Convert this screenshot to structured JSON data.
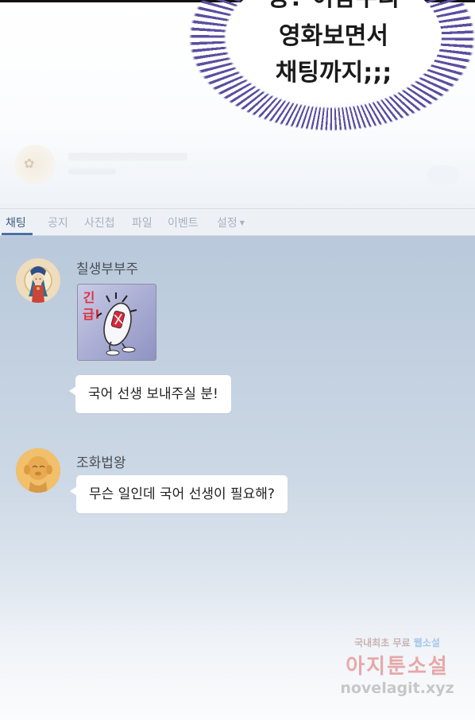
{
  "speech_bubble": {
    "line1": "응? 이참우리",
    "line2": "영화보면서",
    "line3": "채팅까지;;;"
  },
  "tabs": [
    {
      "label": "채팅",
      "active": true
    },
    {
      "label": "공지",
      "active": false
    },
    {
      "label": "사진첩",
      "active": false
    },
    {
      "label": "파일",
      "active": false
    },
    {
      "label": "이벤트",
      "active": false
    },
    {
      "label": "설정",
      "active": false,
      "has_dropdown": true
    }
  ],
  "messages": [
    {
      "sender": "칠생부부주",
      "avatar_icon": "bodhisattva-avatar-icon",
      "sticker": {
        "icon": "emergency-mouse-sticker-icon",
        "text": "긴급!"
      },
      "text": "국어 선생 보내주실 분!"
    },
    {
      "sender": "조화법왕",
      "avatar_icon": "golden-monk-avatar-icon",
      "text": "무슨 일인데 국어 선생이 필요해?"
    }
  ],
  "watermark": {
    "line1_a": "국내최초 무료",
    "line1_b": "웹소설",
    "brand": "아지툰소설",
    "url": "novelagit.xyz"
  },
  "colors": {
    "accent": "#4a6fa5",
    "chat_bg_top": "#b9c9db",
    "bubble_rays": "#5b4ea0",
    "sticker_red": "#e0303a"
  }
}
